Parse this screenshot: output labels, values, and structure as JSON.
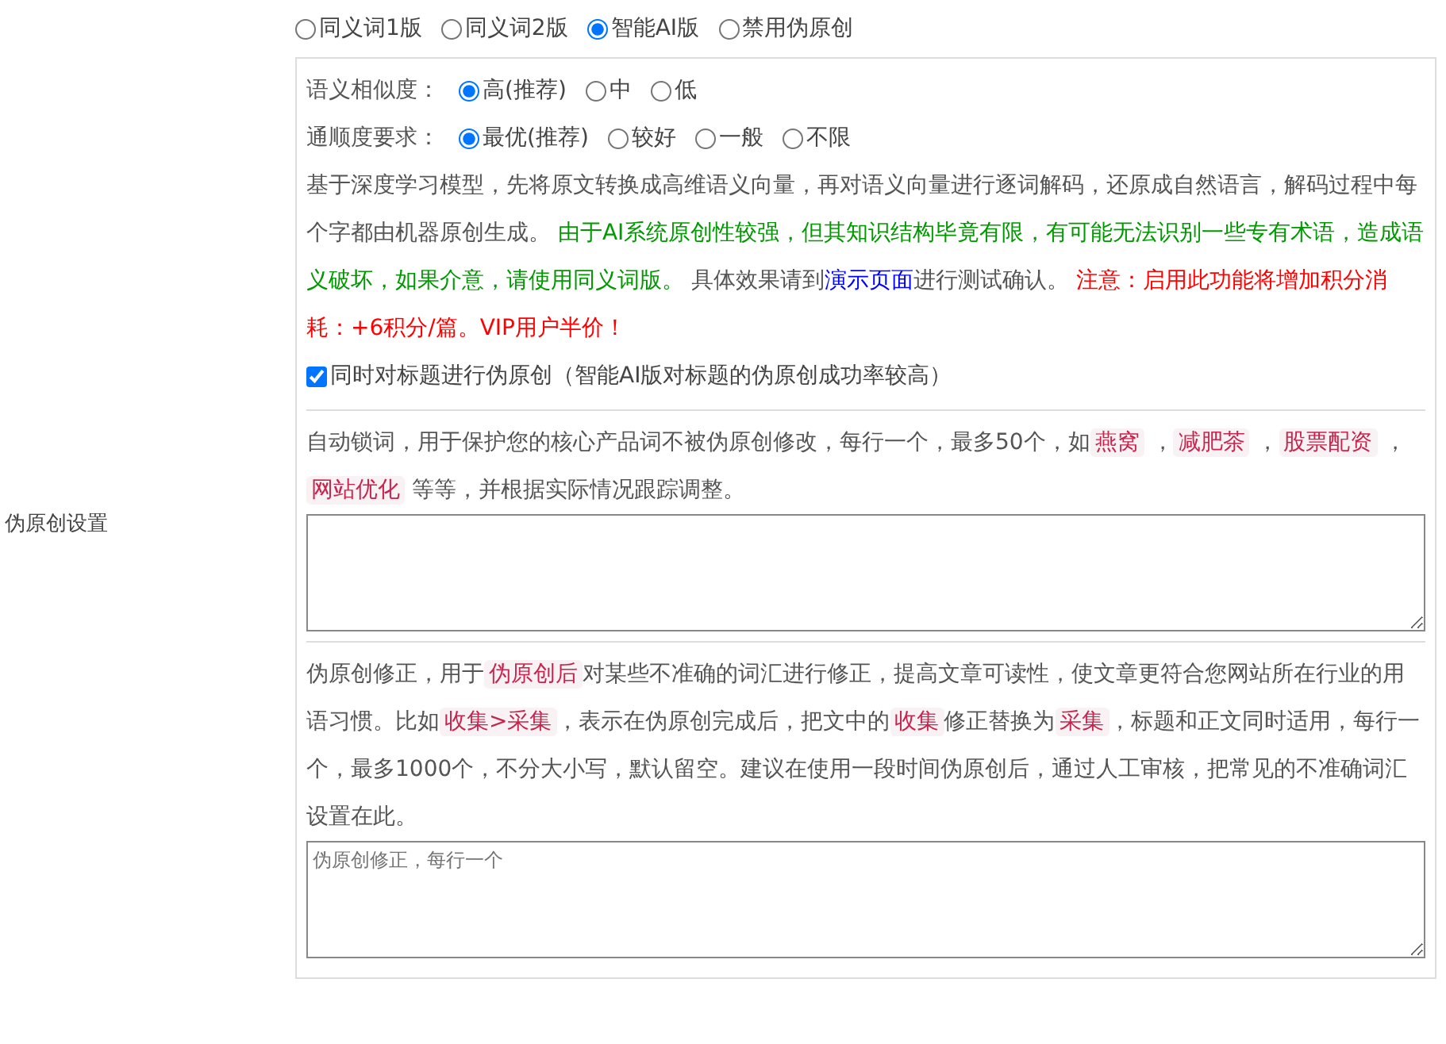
{
  "side_label": "伪原创设置",
  "mode_options": [
    {
      "label": "同义词1版",
      "selected": false
    },
    {
      "label": "同义词2版",
      "selected": false
    },
    {
      "label": "智能AI版",
      "selected": true
    },
    {
      "label": "禁用伪原创",
      "selected": false
    }
  ],
  "similarity": {
    "label": "语义相似度：",
    "options": [
      {
        "label": "高(推荐)",
        "selected": true
      },
      {
        "label": "中",
        "selected": false
      },
      {
        "label": "低",
        "selected": false
      }
    ]
  },
  "fluency": {
    "label": "通顺度要求：",
    "options": [
      {
        "label": "最优(推荐)",
        "selected": true
      },
      {
        "label": "较好",
        "selected": false
      },
      {
        "label": "一般",
        "selected": false
      },
      {
        "label": "不限",
        "selected": false
      }
    ]
  },
  "ai_description": [
    {
      "kind": "plain",
      "text": "基于深度学习模型，先将原文转换成高维语义向量，再对语义向量进行逐词解码，还原成自然语言，解码过程中每个字都由机器原创生成。 "
    },
    {
      "kind": "green",
      "text": "由于AI系统原创性较强，但其知识结构毕竟有限，有可能无法识别一些专有术语，造成语义破坏，如果介意，请使用同义词版。"
    },
    {
      "kind": "plain",
      "text": " 具体效果请到"
    },
    {
      "kind": "link",
      "text": "演示页面"
    },
    {
      "kind": "plain",
      "text": "进行测试确认。 "
    },
    {
      "kind": "red",
      "text": "注意：启用此功能将增加积分消耗：+6积分/篇。VIP用户半价！"
    }
  ],
  "title_option": {
    "label": "同时对标题进行伪原创（智能AI版对标题的伪原创成功率较高）",
    "checked": true
  },
  "lock_description": [
    {
      "kind": "plain",
      "text": "自动锁词，用于保护您的核心产品词不被伪原创修改，每行一个，最多50个，如"
    },
    {
      "kind": "code",
      "text": "燕窝"
    },
    {
      "kind": "plain",
      "text": " ，"
    },
    {
      "kind": "code",
      "text": "减肥茶"
    },
    {
      "kind": "plain",
      "text": " ，"
    },
    {
      "kind": "code",
      "text": "股票配资"
    },
    {
      "kind": "plain",
      "text": " ，"
    },
    {
      "kind": "code",
      "text": "网站优化"
    },
    {
      "kind": "plain",
      "text": " 等等，并根据实际情况跟踪调整。"
    }
  ],
  "correction_description": [
    {
      "kind": "plain",
      "text": "伪原创修正，用于"
    },
    {
      "kind": "code",
      "text": "伪原创后"
    },
    {
      "kind": "plain",
      "text": "对某些不准确的词汇进行修正，提高文章可读性，使文章更符合您网站所在行业的用语习惯。比如"
    },
    {
      "kind": "code",
      "text": "收集>采集"
    },
    {
      "kind": "plain",
      "text": "，表示在伪原创完成后，把文中的"
    },
    {
      "kind": "code",
      "text": "收集"
    },
    {
      "kind": "plain",
      "text": "修正替换为"
    },
    {
      "kind": "code",
      "text": "采集"
    },
    {
      "kind": "plain",
      "text": "，标题和正文同时适用，每行一个，最多1000个，不分大小写，默认留空。建议在使用一段时间伪原创后，通过人工审核，把常见的不准确词汇设置在此。"
    }
  ],
  "correction_field": {
    "placeholder": "伪原创修正，每行一个"
  }
}
